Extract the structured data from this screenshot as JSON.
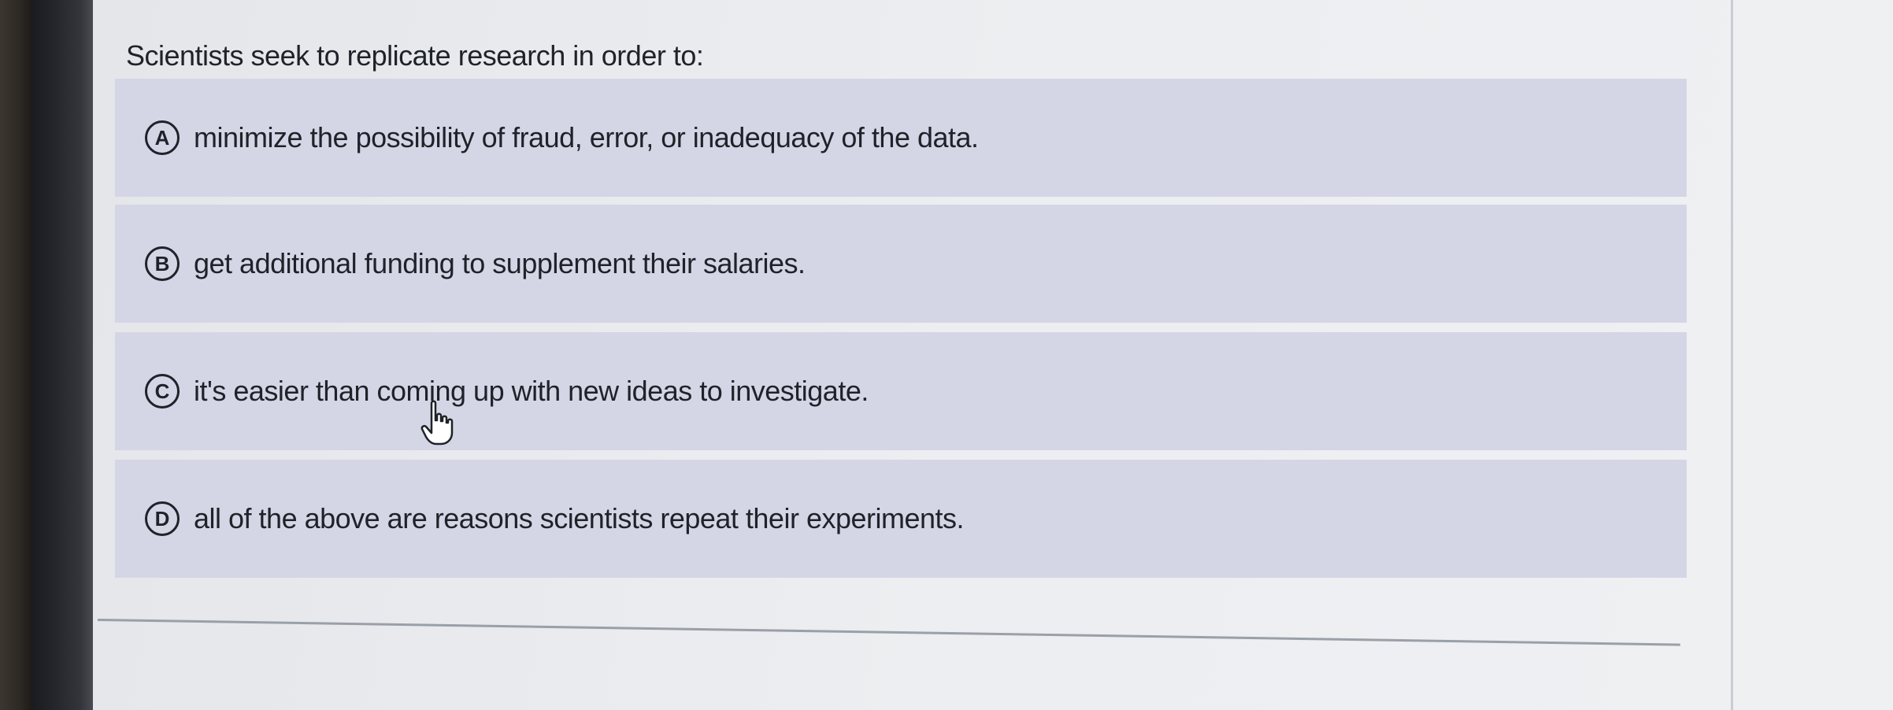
{
  "question": {
    "prompt": "Scientists seek to replicate research in order to:",
    "options": [
      {
        "letter": "A",
        "text": "minimize the possibility of fraud, error, or inadequacy of the data."
      },
      {
        "letter": "B",
        "text": "get additional funding to supplement their salaries."
      },
      {
        "letter": "C",
        "text": "it's easier than coming up with new ideas to investigate."
      },
      {
        "letter": "D",
        "text": "all of the above are reasons scientists repeat their experiments."
      }
    ]
  },
  "colors": {
    "option_background": "#d4d6e6",
    "page_background": "#eceef1",
    "text": "#1f2228"
  },
  "cursor": {
    "icon": "hand-pointer-icon"
  }
}
